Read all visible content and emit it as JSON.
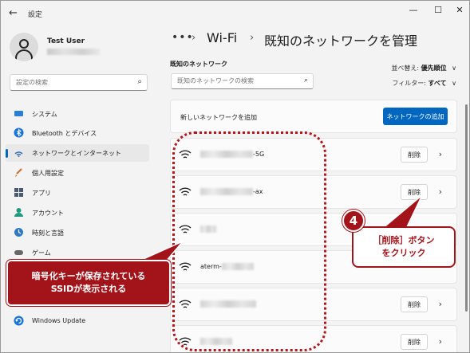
{
  "window": {
    "title": "設定",
    "back_glyph": "←",
    "minimize_glyph": "—",
    "maximize_glyph": "☐",
    "close_glyph": "✕"
  },
  "user": {
    "name": "Test User"
  },
  "sidebar": {
    "search_placeholder": "設定の検索",
    "items": [
      {
        "label": "システム",
        "icon": "monitor-icon"
      },
      {
        "label": "Bluetooth とデバイス",
        "icon": "bluetooth-icon"
      },
      {
        "label": "ネットワークとインターネット",
        "icon": "network-icon",
        "selected": true
      },
      {
        "label": "個人用設定",
        "icon": "brush-icon"
      },
      {
        "label": "アプリ",
        "icon": "apps-icon"
      },
      {
        "label": "アカウント",
        "icon": "account-icon"
      },
      {
        "label": "時刻と言語",
        "icon": "globe-clock-icon"
      },
      {
        "label": "ゲーム",
        "icon": "game-icon"
      },
      {
        "label": "Windows Update",
        "icon": "update-icon"
      }
    ]
  },
  "breadcrumb": {
    "dots": "•••",
    "sep": "›",
    "parent": "Wi-Fi",
    "current": "既知のネットワークを管理"
  },
  "known_networks": {
    "section_title": "既知のネットワーク",
    "search_placeholder": "既知のネットワークの検索",
    "sort_label": "並べ替え:",
    "sort_value": "優先順位",
    "filter_label": "フィルター:",
    "filter_value": "すべて",
    "add_label": "新しいネットワークを追加",
    "add_button": "ネットワークの追加",
    "delete_label": "削除",
    "networks": [
      {
        "suffix": "-5G",
        "show_delete": true
      },
      {
        "suffix": "-ax",
        "show_delete": true
      },
      {
        "suffix": "",
        "show_delete": false
      },
      {
        "suffix": "aterm-",
        "show_delete": false
      },
      {
        "suffix": "",
        "show_delete": true
      },
      {
        "suffix": "",
        "show_delete": true
      }
    ]
  },
  "annotations": {
    "left_callout_line1": "暗号化キーが保存されている",
    "left_callout_line2": "SSIDが表示される",
    "step_number": "4",
    "right_callout_line1": "［削除］ボタン",
    "right_callout_line2": "をクリック",
    "color": "#a2141a"
  }
}
